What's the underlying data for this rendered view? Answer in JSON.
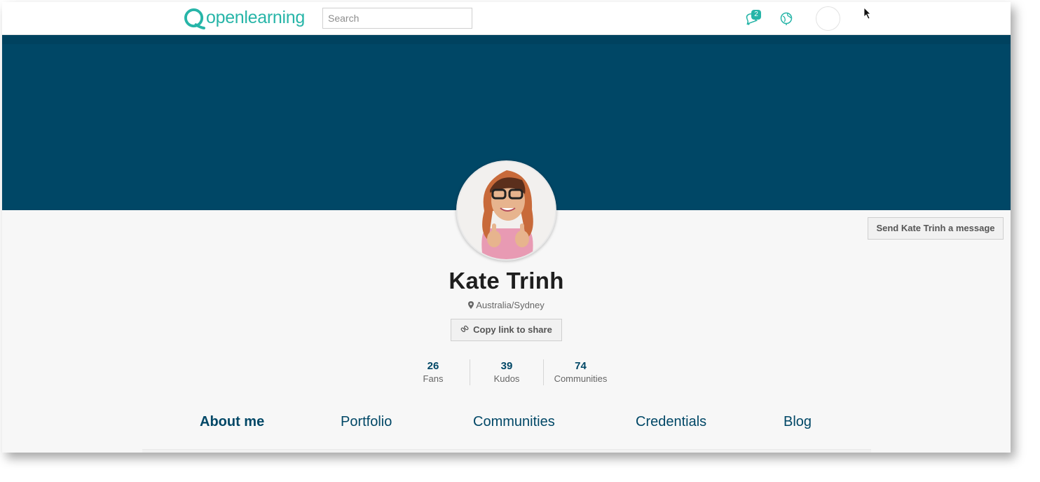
{
  "brand": {
    "name": "openlearning",
    "color": "#27b5a8"
  },
  "search": {
    "placeholder": "Search"
  },
  "nav": {
    "notification_count": "2",
    "icons": [
      "bell-icon",
      "globe-icon",
      "user-avatar"
    ]
  },
  "colors": {
    "banner": "#004766",
    "accent": "#27b5a8",
    "link": "#004766"
  },
  "profile": {
    "name": "Kate Trinh",
    "location": "Australia/Sydney",
    "message_button": "Send Kate Trinh a message",
    "share_button": "Copy link to share"
  },
  "stats": [
    {
      "value": "26",
      "label": "Fans"
    },
    {
      "value": "39",
      "label": "Kudos"
    },
    {
      "value": "74",
      "label": "Communities"
    }
  ],
  "tabs": [
    {
      "label": "About me",
      "active": true
    },
    {
      "label": "Portfolio",
      "active": false
    },
    {
      "label": "Communities",
      "active": false
    },
    {
      "label": "Credentials",
      "active": false
    },
    {
      "label": "Blog",
      "active": false
    }
  ]
}
